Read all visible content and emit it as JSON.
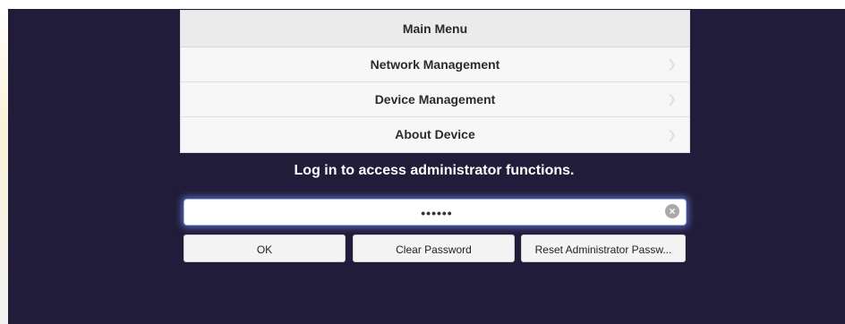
{
  "menu": {
    "title": "Main Menu",
    "items": [
      {
        "label": "Network Management",
        "icon": "chevron-right-icon"
      },
      {
        "label": "Device Management",
        "icon": "chevron-right-icon"
      },
      {
        "label": "About Device",
        "icon": "chevron-right-icon"
      }
    ]
  },
  "login": {
    "prompt": "Log in to access administrator functions.",
    "password_value": "••••••",
    "clear_icon": "clear-circle-icon"
  },
  "buttons": {
    "ok": "OK",
    "clear": "Clear Password",
    "reset": "Reset Administrator Passw..."
  },
  "colors": {
    "background": "#211c3a",
    "menu": "#f6f6f6",
    "focus_glow": "#9fb6e8"
  }
}
